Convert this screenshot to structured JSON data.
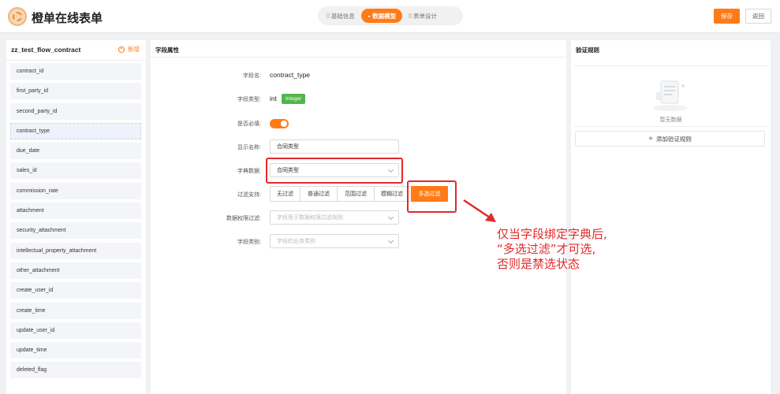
{
  "app": {
    "title": "橙单在线表单"
  },
  "tabs": [
    {
      "label": "基础信息",
      "icon": "document-icon",
      "active": false
    },
    {
      "label": "数据模型",
      "icon": "database-icon",
      "active": true
    },
    {
      "label": "表单设计",
      "icon": "form-icon",
      "active": false
    }
  ],
  "header": {
    "save_label": "保存",
    "back_label": "返回"
  },
  "left": {
    "title": "zz_test_flow_contract",
    "add_label": "新增",
    "fields": [
      "contract_id",
      "first_party_id",
      "second_party_id",
      "contract_type",
      "due_date",
      "sales_id",
      "commission_rate",
      "attachment",
      "security_attachment",
      "intellectual_property_attachment",
      "other_attachment",
      "create_user_id",
      "create_time",
      "update_user_id",
      "update_time",
      "deleted_flag"
    ],
    "selected": "contract_type"
  },
  "props": {
    "title": "字段属性",
    "field_name_label": "字段名:",
    "field_name_value": "contract_type",
    "field_type_label": "字段类型:",
    "field_type_value": "int",
    "field_type_tag": "Integer",
    "required_label": "是否必填:",
    "required_on": true,
    "display_name_label": "显示名称:",
    "display_name_value": "合同类型",
    "dict_label": "字典数据:",
    "dict_value": "合同类型",
    "filter_label": "过滤支持:",
    "filter_options": [
      "无过滤",
      "普通过滤",
      "范围过滤",
      "模糊过滤",
      "多选过滤"
    ],
    "filter_selected": "多选过滤",
    "perm_filter_label": "数据权限过滤:",
    "perm_filter_placeholder": "字段用于数据权限过滤规则",
    "category_label": "字段类别:",
    "category_placeholder": "字段的业务类别"
  },
  "rules": {
    "title": "验证规则",
    "empty_text": "暂无数据",
    "add_label": "添加验证规则"
  },
  "annotation": {
    "line1": "仅当字段绑定字典后,",
    "line2": "“多选过滤”才可选,",
    "line3": "否则是禁选状态"
  },
  "colors": {
    "accent": "#ff7b18",
    "annotation": "#e02a2a",
    "tag_green": "#52b64a"
  }
}
